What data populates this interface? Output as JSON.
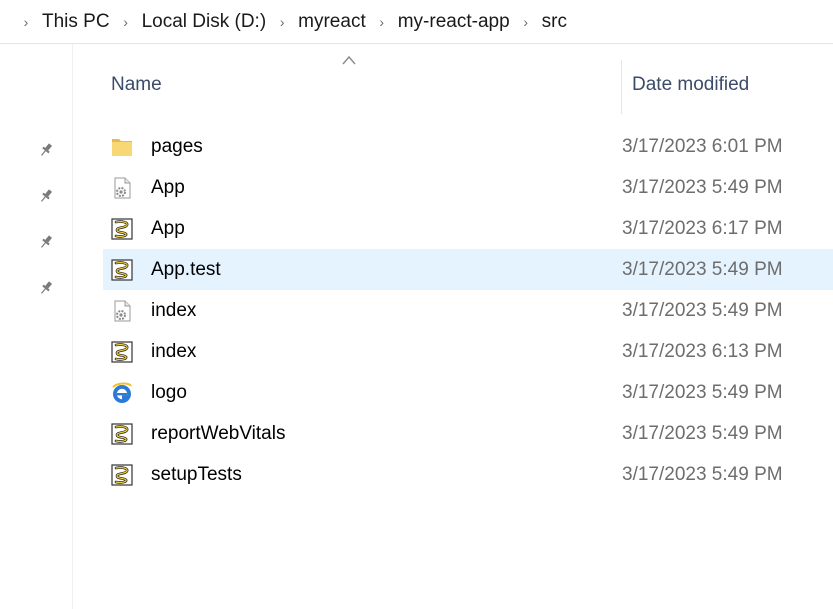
{
  "breadcrumb": {
    "items": [
      "This PC",
      "Local Disk (D:)",
      "myreact",
      "my-react-app",
      "src"
    ]
  },
  "columns": {
    "name": "Name",
    "date_modified": "Date modified"
  },
  "files": [
    {
      "name": "pages",
      "date": "3/17/2023 6:01 PM",
      "icon": "folder-icon"
    },
    {
      "name": "App",
      "date": "3/17/2023 5:49 PM",
      "icon": "settings-file-icon"
    },
    {
      "name": "App",
      "date": "3/17/2023 6:17 PM",
      "icon": "script-file-icon"
    },
    {
      "name": "App.test",
      "date": "3/17/2023 5:49 PM",
      "icon": "script-file-icon"
    },
    {
      "name": "index",
      "date": "3/17/2023 5:49 PM",
      "icon": "settings-file-icon"
    },
    {
      "name": "index",
      "date": "3/17/2023 6:13 PM",
      "icon": "script-file-icon"
    },
    {
      "name": "logo",
      "date": "3/17/2023 5:49 PM",
      "icon": "browser-file-icon"
    },
    {
      "name": "reportWebVitals",
      "date": "3/17/2023 5:49 PM",
      "icon": "script-file-icon"
    },
    {
      "name": "setupTests",
      "date": "3/17/2023 5:49 PM",
      "icon": "script-file-icon"
    }
  ],
  "selected_row": "App.test",
  "colors": {
    "selection": "#e5f3ff",
    "header_text": "#3b4b6a",
    "date_text": "#6d6d6d",
    "folder": "#f8d775"
  }
}
